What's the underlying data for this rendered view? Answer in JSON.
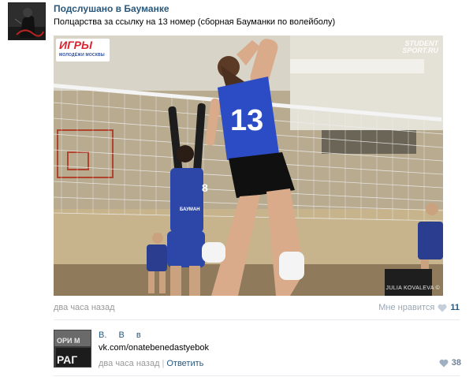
{
  "post": {
    "group_name": "Подслушано в Бауманке",
    "text": "Полцарства за ссылку на 13 номер (сборная Бауманки по волейболу)",
    "photo": {
      "logo_left": "ИГРЫ",
      "logo_left_sub": "МОЛОДЁЖИ МОСКВЫ",
      "logo_right_line1": "STUDENT",
      "logo_right_line2": "SPORT.RU",
      "credit": "JULIA KOVALEVA ©",
      "jersey_main": "13",
      "jersey_blocker": "8",
      "jersey_blocker_text": "БАУМАН"
    },
    "time": "два часа назад",
    "like_label": "Мне нравится",
    "like_count": "11"
  },
  "comment": {
    "author": "В. В в",
    "text": "vk.com/onatebenedastyebok",
    "time": "два часа назад",
    "separator": "|",
    "reply_label": "Ответить",
    "like_count": "38"
  },
  "colors": {
    "link": "#2b587a",
    "meta": "#999999",
    "heart": "#c4cfda"
  },
  "icons": {
    "heart": "heart-icon"
  }
}
